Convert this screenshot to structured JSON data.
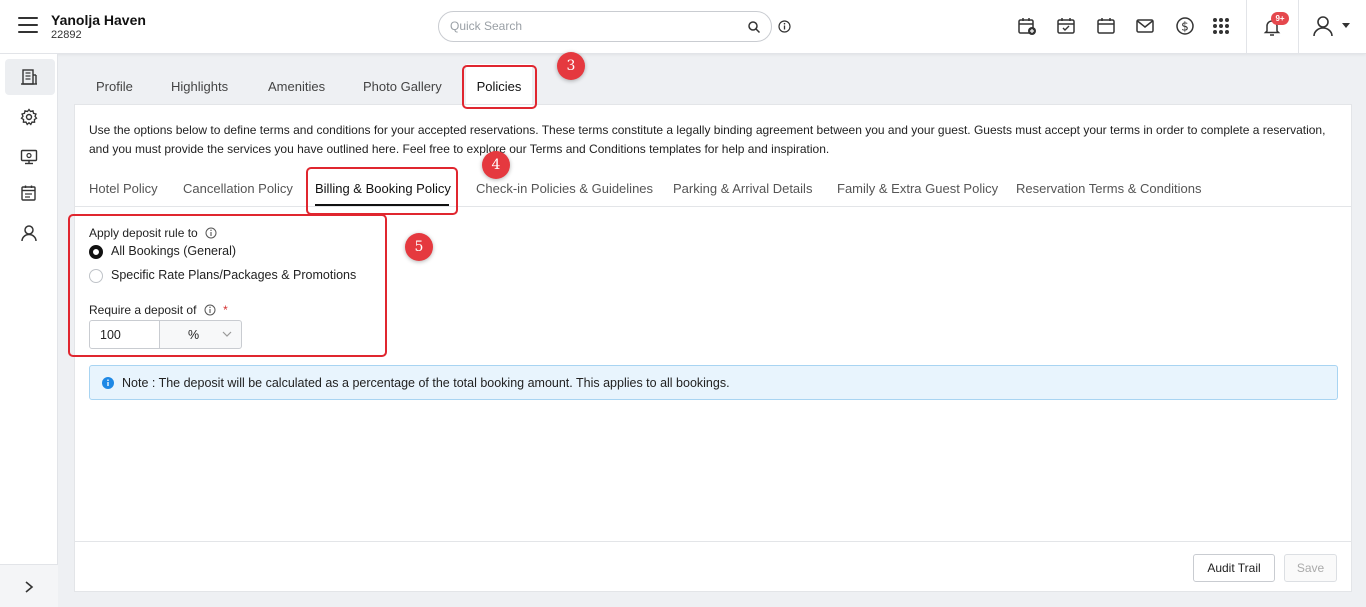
{
  "header": {
    "hotel_name": "Yanolja Haven",
    "hotel_id": "22892",
    "search_placeholder": "Quick Search",
    "notification_badge": "9+",
    "icons": [
      "calendar-plus-icon",
      "calendar-check-icon",
      "calendar-icon",
      "mail-icon",
      "dollar-icon",
      "apps-grid-icon",
      "bell-icon",
      "user-icon"
    ]
  },
  "sidebar": {
    "items": [
      "property-icon",
      "settings-icon",
      "monitor-icon",
      "calendar-list-icon",
      "user-icon"
    ],
    "expand_icon": "chevron-right-icon"
  },
  "main_tabs": [
    {
      "label": "Profile"
    },
    {
      "label": "Highlights"
    },
    {
      "label": "Amenities"
    },
    {
      "label": "Photo Gallery"
    },
    {
      "label": "Policies",
      "active": true
    }
  ],
  "intro_text": "Use the options below to define terms and conditions for your accepted reservations. These terms constitute a legally binding agreement between you and your guest. Guests must accept your terms in order to complete a reservation, and you must provide the services you have outlined here. Feel free to explore our Terms and Conditions templates for help and inspiration.",
  "sub_tabs": [
    {
      "label": "Hotel Policy"
    },
    {
      "label": "Cancellation Policy"
    },
    {
      "label": "Billing & Booking Policy",
      "active": true
    },
    {
      "label": "Check-in Policies & Guidelines"
    },
    {
      "label": "Parking & Arrival Details"
    },
    {
      "label": "Family & Extra Guest Policy"
    },
    {
      "label": "Reservation Terms & Conditions"
    }
  ],
  "deposit": {
    "apply_label": "Apply deposit rule to",
    "options": [
      {
        "label": "All Bookings (General)",
        "checked": true
      },
      {
        "label": "Specific Rate Plans/Packages & Promotions",
        "checked": false
      }
    ],
    "require_label": "Require a deposit of",
    "required_mark": "*",
    "value": "100",
    "unit": "%"
  },
  "note": "Note : The deposit will be calculated as a percentage of the total booking amount. This applies to all bookings.",
  "footer": {
    "audit_label": "Audit Trail",
    "save_label": "Save"
  },
  "annotations": [
    "3",
    "4",
    "5"
  ],
  "colors": {
    "annotation_red": "#e5393f",
    "note_background": "#e8f4fd",
    "note_border": "#a8d4f2",
    "info_blue": "#1e88e5"
  }
}
